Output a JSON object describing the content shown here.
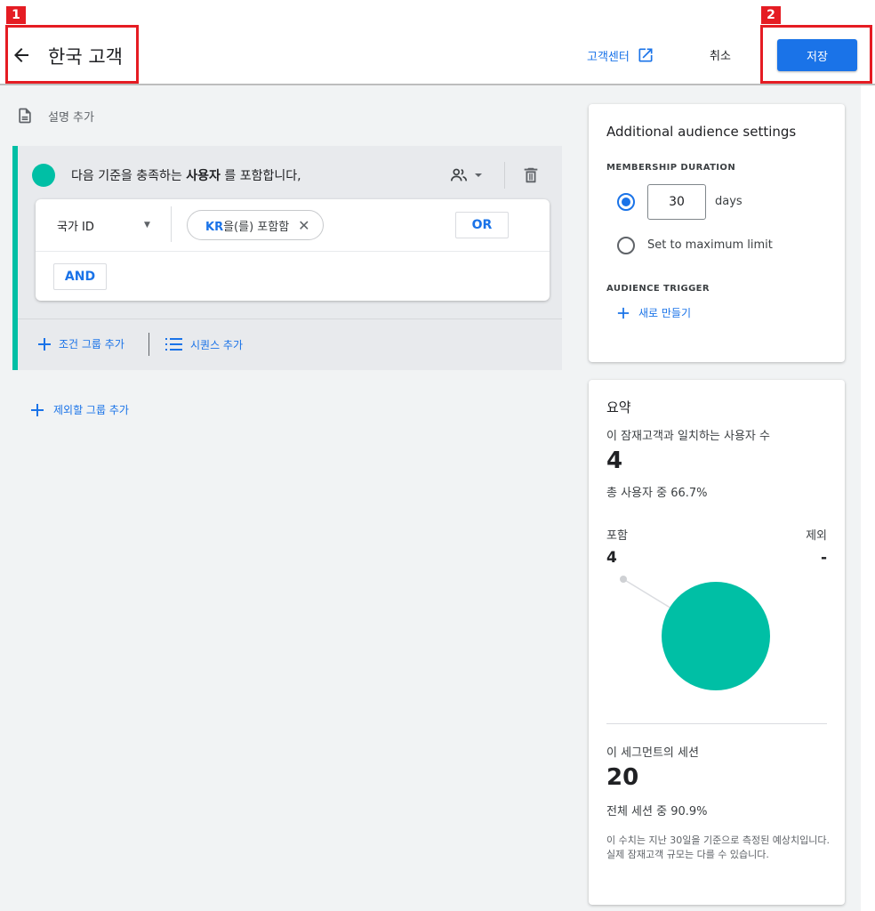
{
  "callouts": [
    {
      "label": "1"
    },
    {
      "label": "2"
    }
  ],
  "header": {
    "title": "한국 고객",
    "help_center": "고객센터",
    "cancel": "취소",
    "save": "저장"
  },
  "builder": {
    "add_description": "설명 추가",
    "include_group": {
      "prefix": "다음 기준을 충족하는 ",
      "subject": "사용자",
      "suffix": " 를 포함합니다,",
      "condition": {
        "dimension": "국가 ID",
        "chip_value": "KR",
        "chip_text": "을(를) 포함함",
        "or_label": "OR",
        "and_label": "AND"
      },
      "add_condition_group": "조건 그룹 추가",
      "add_sequence": "시퀀스 추가"
    },
    "add_exclude_group": "제외할 그룹 추가"
  },
  "settings": {
    "title": "Additional audience settings",
    "membership_label": "MEMBERSHIP DURATION",
    "days_value": "30",
    "days_unit": "days",
    "max_limit": "Set to maximum limit",
    "trigger_label": "AUDIENCE TRIGGER",
    "create_new": "새로 만들기"
  },
  "summary": {
    "title": "요약",
    "matching_users_label": "이 잠재고객과 일치하는 사용자 수",
    "matching_users": "4",
    "of_total": "총 사용자 중 66.7%",
    "include_label": "포함",
    "include_value": "4",
    "exclude_label": "제외",
    "exclude_value": "-",
    "sessions_label": "이 세그먼트의 세션",
    "sessions": "20",
    "sessions_pct": "전체 세션 중 90.9%",
    "note": "이 수치는 지난 30일을 기준으로 측정된 예상치입니다. 실제 잠재고객 규모는 다를 수 있습니다."
  },
  "colors": {
    "accent": "#1a73e8",
    "teal": "#00bfa5",
    "callout": "#e51c23"
  }
}
